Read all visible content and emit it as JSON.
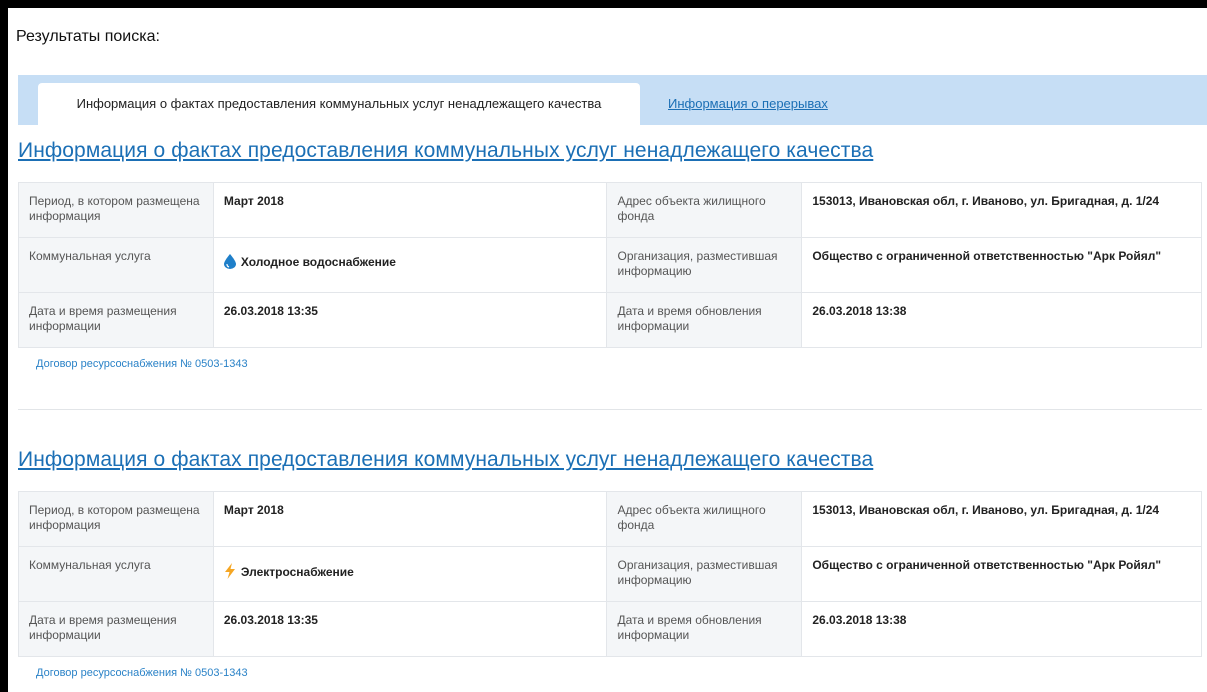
{
  "search": {
    "title": "Результаты поиска:"
  },
  "tabs": [
    {
      "label": "Информация о фактах предоставления коммунальных услуг ненадлежащего качества",
      "active": true
    },
    {
      "label": "Информация о перерывах",
      "active": false
    }
  ],
  "labels": {
    "period": "Период, в котором размещена информация",
    "service": "Коммунальная услуга",
    "posted": "Дата и время размещения информации",
    "address": "Адрес объекта жилищного фонда",
    "org": "Организация, разместившая информацию",
    "updated": "Дата и время обновления информации"
  },
  "records": [
    {
      "title": "Информация о фактах предоставления коммунальных услуг ненадлежащего качества",
      "period": "Март 2018",
      "address": "153013, Ивановская обл, г. Иваново, ул. Бригадная, д. 1/24",
      "service": "Холодное водоснабжение",
      "service_icon": "water-drop-icon",
      "org": "Общество с ограниченной ответственностью \"Арк Ройял\"",
      "posted": "26.03.2018 13:35",
      "updated": "26.03.2018 13:38",
      "contract": "Договор ресурсоснабжения № 0503-1343"
    },
    {
      "title": "Информация о фактах предоставления коммунальных услуг ненадлежащего качества",
      "period": "Март 2018",
      "address": "153013, Ивановская обл, г. Иваново, ул. Бригадная, д. 1/24",
      "service": "Электроснабжение",
      "service_icon": "lightning-icon",
      "org": "Общество с ограниченной ответственностью \"Арк Ройял\"",
      "posted": "26.03.2018 13:35",
      "updated": "26.03.2018 13:38",
      "contract": "Договор ресурсоснабжения № 0503-1343"
    }
  ],
  "colors": {
    "link": "#1b6fb5",
    "tabbar": "#c6def5",
    "water": "#1f7fc9",
    "electric": "#f5a623"
  }
}
